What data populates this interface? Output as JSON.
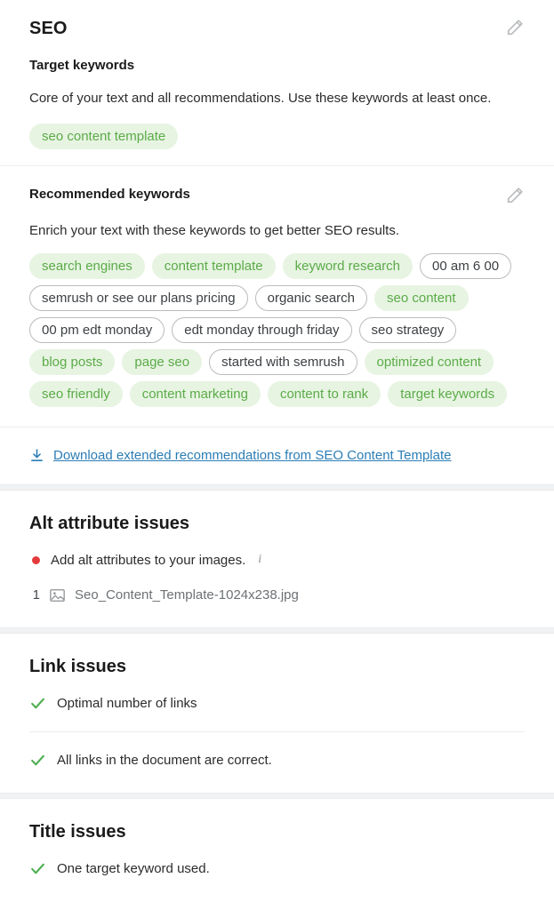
{
  "panel": {
    "title": "SEO",
    "edit_icon": "pencil-icon"
  },
  "target_keywords": {
    "heading": "Target keywords",
    "description": "Core of your text and all recommendations. Use these keywords at least once.",
    "chips": [
      {
        "label": "seo content template",
        "style": "green"
      }
    ]
  },
  "recommended_keywords": {
    "heading": "Recommended keywords",
    "description": "Enrich your text with these keywords to get better SEO results.",
    "edit_icon": "pencil-icon",
    "chips": [
      {
        "label": "search engines",
        "style": "green"
      },
      {
        "label": "content template",
        "style": "green"
      },
      {
        "label": "keyword research",
        "style": "green"
      },
      {
        "label": "00 am 6 00",
        "style": "outline"
      },
      {
        "label": "semrush or see our plans pricing",
        "style": "outline"
      },
      {
        "label": "organic search",
        "style": "outline"
      },
      {
        "label": "seo content",
        "style": "green"
      },
      {
        "label": "00 pm edt monday",
        "style": "outline"
      },
      {
        "label": "edt monday through friday",
        "style": "outline"
      },
      {
        "label": "seo strategy",
        "style": "outline"
      },
      {
        "label": "blog posts",
        "style": "green"
      },
      {
        "label": "page seo",
        "style": "green"
      },
      {
        "label": "started with semrush",
        "style": "outline"
      },
      {
        "label": "optimized content",
        "style": "green"
      },
      {
        "label": "seo friendly",
        "style": "green"
      },
      {
        "label": "content marketing",
        "style": "green"
      },
      {
        "label": "content to rank",
        "style": "green"
      },
      {
        "label": "target keywords",
        "style": "green"
      }
    ]
  },
  "download": {
    "icon": "download-icon",
    "label": "Download extended recommendations from SEO Content Template"
  },
  "alt_attribute_issues": {
    "heading": "Alt attribute issues",
    "issue": {
      "status": "error",
      "text": "Add alt attributes to your images.",
      "info_icon": "info-icon"
    },
    "images": [
      {
        "index": "1",
        "icon": "image-icon",
        "filename": "Seo_Content_Template-1024x238.jpg"
      }
    ]
  },
  "link_issues": {
    "heading": "Link issues",
    "items": [
      {
        "status": "ok",
        "text": "Optimal number of links"
      },
      {
        "status": "ok",
        "text": "All links in the document are correct."
      }
    ]
  },
  "title_issues": {
    "heading": "Title issues",
    "items": [
      {
        "status": "ok",
        "text": "One target keyword used."
      }
    ]
  },
  "colors": {
    "chip_green_bg": "#e7f4e2",
    "chip_green_text": "#5bab48",
    "chip_outline_border": "#b9bcbe",
    "chip_outline_text": "#3d4144",
    "link_blue": "#2b7db5",
    "error_red": "#e33b3b",
    "success_green": "#4caf50",
    "separator_grey": "#f1f2f3"
  }
}
